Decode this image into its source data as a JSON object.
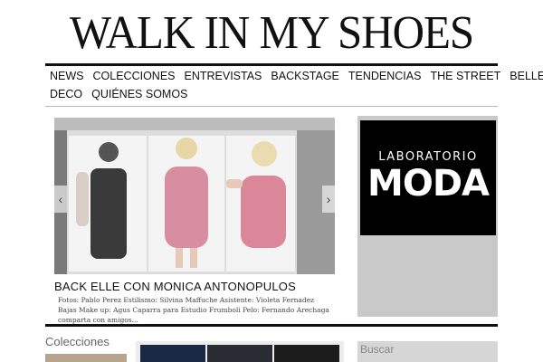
{
  "site": {
    "title": "WALK IN MY SHOES"
  },
  "nav": {
    "items": [
      "NEWS",
      "COLECCIONES",
      "ENTREVISTAS",
      "BACKSTAGE",
      "TENDENCIAS",
      "THE STREET",
      "BELLEZA",
      "DECO",
      "QUIÉNES SOMOS"
    ]
  },
  "featured": {
    "title": "BACK ELLE CON MONICA ANTONOPULOS",
    "caption": "Fotos: Pablo Perez Estilismo: Silvina Maffuche Asistente: Violeta Fernadez Bajas Make up: Agus Caparra para Estudio Frumboli Pelo: Fernando Arechaga comparta con amigos...",
    "prev_icon": "chevron-left-icon",
    "next_icon": "chevron-right-icon"
  },
  "ad": {
    "line1": "LABORATORIO",
    "line2": "MODA"
  },
  "colecciones": {
    "title": "Colecciones"
  },
  "search": {
    "label": "Buscar"
  },
  "colors": {
    "ad_bg": "#000000",
    "sidebar_gray": "#c9c9c9",
    "rule": "#111111"
  }
}
